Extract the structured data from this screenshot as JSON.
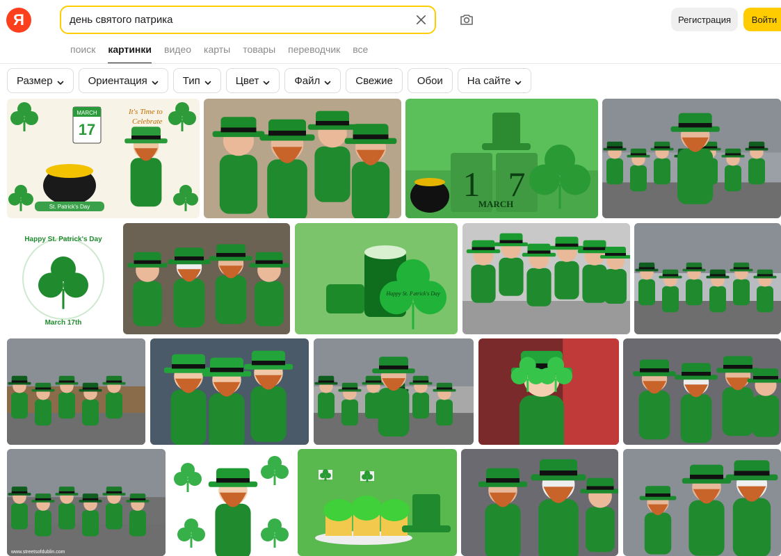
{
  "header": {
    "logo_letter": "Я",
    "search_value": "день святого патрика",
    "register_label": "Регистрация",
    "login_label": "Войти",
    "brand_color": "#fc3f1d",
    "accent_color": "#ffcc00"
  },
  "tabs": [
    {
      "label": "поиск",
      "active": false
    },
    {
      "label": "картинки",
      "active": true
    },
    {
      "label": "видео",
      "active": false
    },
    {
      "label": "карты",
      "active": false
    },
    {
      "label": "товары",
      "active": false
    },
    {
      "label": "переводчик",
      "active": false
    },
    {
      "label": "все",
      "active": false
    }
  ],
  "filters": [
    {
      "label": "Размер",
      "dropdown": true
    },
    {
      "label": "Ориентация",
      "dropdown": true
    },
    {
      "label": "Тип",
      "dropdown": true
    },
    {
      "label": "Цвет",
      "dropdown": true
    },
    {
      "label": "Файл",
      "dropdown": true
    },
    {
      "label": "Свежие",
      "dropdown": false
    },
    {
      "label": "Обои",
      "dropdown": false
    },
    {
      "label": "На сайте",
      "dropdown": true
    }
  ],
  "images": [
    {
      "kind": "leprechaun-clipart",
      "caption": "",
      "overlay_text": [
        "It's Time to",
        "Celebrate",
        "MARCH",
        "17",
        "St. Patrick's Day"
      ]
    },
    {
      "kind": "people-green-hats",
      "overlay_text": []
    },
    {
      "kind": "calendar-17-march",
      "overlay_text": [
        "1",
        "7",
        "MARCH"
      ]
    },
    {
      "kind": "parade-crowd",
      "overlay_text": []
    },
    {
      "kind": "shamrock-wreath",
      "overlay_text": [
        "Happy St. Patrick's Day",
        "March 17th"
      ]
    },
    {
      "kind": "people-costumes",
      "overlay_text": []
    },
    {
      "kind": "green-beer",
      "overlay_text": [
        "Happy St. Patrick's Day"
      ]
    },
    {
      "kind": "group-jumping",
      "overlay_text": []
    },
    {
      "kind": "city-parade",
      "overlay_text": []
    },
    {
      "kind": "dancers",
      "overlay_text": []
    },
    {
      "kind": "women-hats-beards",
      "overlay_text": []
    },
    {
      "kind": "street-march",
      "overlay_text": []
    },
    {
      "kind": "woman-shamrock-glasses",
      "overlay_text": []
    },
    {
      "kind": "men-costumes",
      "overlay_text": []
    },
    {
      "kind": "marching-band",
      "overlay_text": [
        "www.streetsofdublin.com"
      ]
    },
    {
      "kind": "leprechaun-cartoon",
      "overlay_text": []
    },
    {
      "kind": "cupcakes",
      "overlay_text": []
    },
    {
      "kind": "bearded-men",
      "overlay_text": []
    },
    {
      "kind": "men-beards-street",
      "overlay_text": []
    }
  ]
}
